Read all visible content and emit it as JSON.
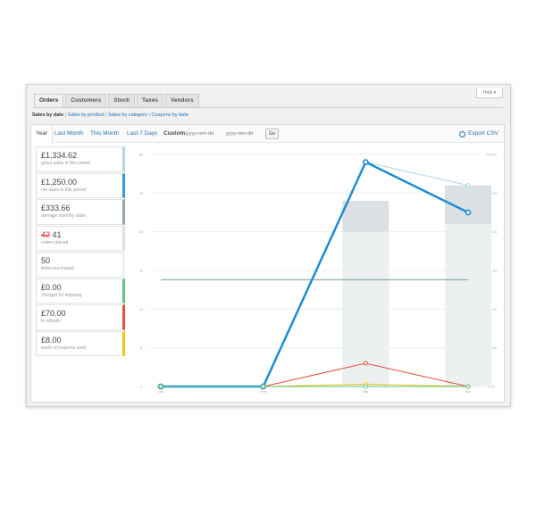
{
  "window": {
    "help_label": "Help ▾"
  },
  "tabs": [
    {
      "label": "Orders",
      "active": true
    },
    {
      "label": "Customers",
      "active": false
    },
    {
      "label": "Stock",
      "active": false
    },
    {
      "label": "Taxes",
      "active": false
    },
    {
      "label": "Vendors",
      "active": false
    }
  ],
  "subnav": {
    "current": "Sales by date",
    "links": [
      "Sales by product",
      "Sales by category",
      "Coupons by date"
    ]
  },
  "ranges": {
    "year": "Year",
    "last_month": "Last Month",
    "this_month": "This Month",
    "last_7_days": "Last 7 Days",
    "custom_label": "Custom:",
    "from_placeholder": "yyyy-mm-dd",
    "to_placeholder": "yyyy-mm-dd",
    "go_label": "Go",
    "export_label": "Export CSV",
    "export_icon": "download-icon"
  },
  "legend": [
    {
      "value": "£1,334.62",
      "label": "gross sales in this period",
      "color": "#b1d4ea"
    },
    {
      "value": "£1,250.00",
      "label": "net sales in this period",
      "color": "#3498db"
    },
    {
      "value": "£333.66",
      "label": "average monthly sales",
      "color": "#95a5a6"
    },
    {
      "value_strike": "42",
      "value": "41",
      "label": "orders placed",
      "color": "#dbe1e3"
    },
    {
      "value": "50",
      "label": "items purchased",
      "color": "#ecf0f1"
    },
    {
      "value": "£0.00",
      "label": "charged for shipping",
      "color": "#5cc488"
    },
    {
      "value": "£70.00",
      "label": "in refunds",
      "color": "#e74c3c"
    },
    {
      "value": "£8.00",
      "label": "worth of coupons used",
      "color": "#f1c40f"
    }
  ],
  "chart_data": {
    "type": "line",
    "categories": [
      "Jan",
      "Feb",
      "Mar",
      "Apr"
    ],
    "left_ylim": [
      0,
      30
    ],
    "left_ticks": [
      "0",
      "5",
      "10",
      "15",
      "20",
      "25",
      "30"
    ],
    "right_ticks": [
      "0.00",
      "120.50",
      "241.00",
      "361.50",
      "482.00",
      "602.50",
      "723.00"
    ],
    "bars": [
      {
        "name": "orders placed",
        "color": "#dbe1e3",
        "values": [
          0,
          0,
          24,
          26
        ]
      },
      {
        "name": "items purchased",
        "color": "#ecf0f1",
        "values": [
          0,
          0,
          20,
          21
        ]
      }
    ],
    "series": [
      {
        "name": "gross sales",
        "color": "#a9d4ec",
        "width": 1,
        "values": [
          0,
          0,
          29,
          26
        ]
      },
      {
        "name": "net sales",
        "color": "#1e8cd3",
        "width": 2.5,
        "values": [
          0,
          0,
          29,
          22.5
        ]
      },
      {
        "name": "refunds",
        "color": "#e74c3c",
        "width": 1,
        "values": [
          0,
          0,
          3,
          0
        ]
      },
      {
        "name": "coupons",
        "color": "#f1c40f",
        "width": 1,
        "values": [
          0,
          0,
          0.3,
          0
        ]
      },
      {
        "name": "shipping",
        "color": "#5cc488",
        "width": 1,
        "values": [
          0,
          0,
          0,
          0
        ]
      }
    ],
    "average": {
      "name": "average monthly sales",
      "color": "#7f9aa6",
      "value": 13.8
    },
    "grid": true
  }
}
